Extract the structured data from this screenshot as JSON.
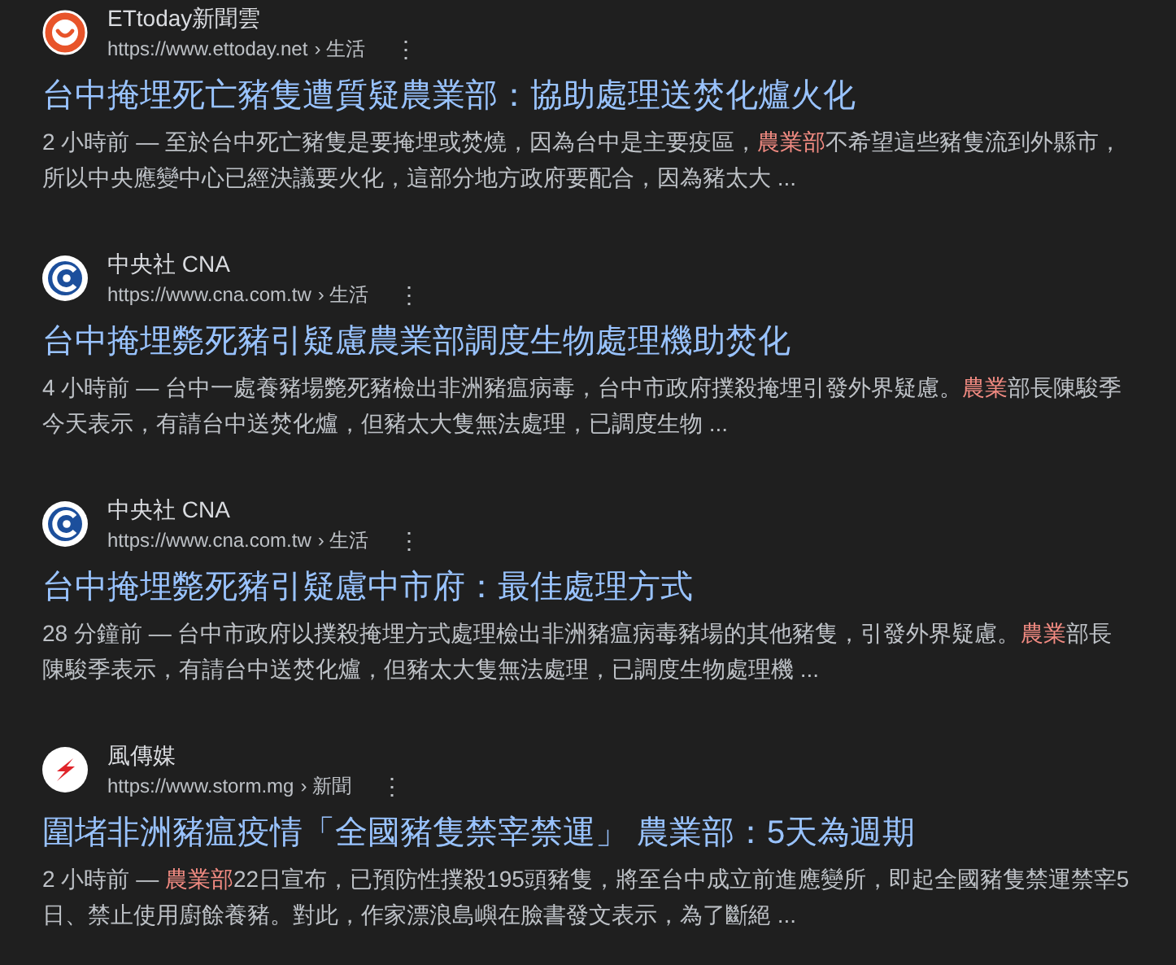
{
  "results": [
    {
      "kind": "smile",
      "site": "ETtoday新聞雲",
      "url": "https://www.ettoday.net",
      "breadcrumb": "› 生活",
      "menu": "⋮",
      "title": "台中掩埋死亡豬隻遭質疑農業部：協助處理送焚化爐火化",
      "snippet": "2 小時前 — 至於台中死亡豬隻是要掩埋或焚燒，因為台中是主要疫區，**農業部**不希望這些豬隻流到外縣市，所以中央應變中心已經決議要火化，這部分地方政府要配合，因為豬太大 ..."
    },
    {
      "kind": "ring",
      "site": "中央社 CNA",
      "url": "https://www.cna.com.tw",
      "breadcrumb": "› 生活",
      "menu": "⋮",
      "title": "台中掩埋斃死豬引疑慮農業部調度生物處理機助焚化",
      "snippet": "4 小時前 — 台中一處養豬場斃死豬檢出非洲豬瘟病毒，台中市政府撲殺掩埋引發外界疑慮。**農業**部長陳駿季今天表示，有請台中送焚化爐，但豬太大隻無法處理，已調度生物 ..."
    },
    {
      "kind": "ring",
      "site": "中央社 CNA",
      "url": "https://www.cna.com.tw",
      "breadcrumb": "› 生活",
      "menu": "⋮",
      "title": "台中掩埋斃死豬引疑慮中市府：最佳處理方式",
      "snippet": "28 分鐘前 — 台中市政府以撲殺掩埋方式處理檢出非洲豬瘟病毒豬場的其他豬隻，引發外界疑慮。**農業**部長陳駿季表示，有請台中送焚化爐，但豬太大隻無法處理，已調度生物處理機 ..."
    },
    {
      "kind": "bolt",
      "site": "風傳媒",
      "url": "https://www.storm.mg",
      "breadcrumb": "› 新聞",
      "menu": "⋮",
      "title": "圍堵非洲豬瘟疫情「全國豬隻禁宰禁運」 農業部：5天為週期",
      "snippet": "2 小時前 — **農業部**22日宣布，已預防性撲殺195頭豬隻，將至台中成立前進應變所，即起全國豬隻禁運禁宰5日、禁止使用廚餘養豬。對此，作家漂浪島嶼在臉書發文表示，為了斷絕 ..."
    }
  ]
}
